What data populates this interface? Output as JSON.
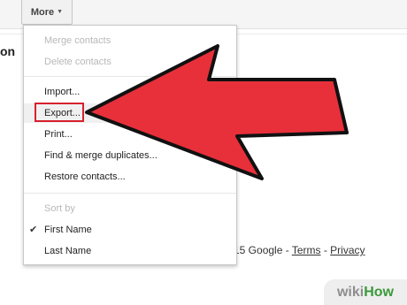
{
  "toolbar": {
    "more_label": "More",
    "more_caret": "▼"
  },
  "page": {
    "heading_fragment": "on"
  },
  "menu": {
    "merge": "Merge contacts",
    "delete": "Delete contacts",
    "import": "Import...",
    "export": "Export...",
    "print": "Print...",
    "find_merge": "Find & merge duplicates...",
    "restore": "Restore contacts...",
    "sort_by": "Sort by",
    "first_name": "First Name",
    "last_name": "Last Name",
    "check_glyph": "✔"
  },
  "footer": {
    "copyright": "15 Google - ",
    "sep": " - ",
    "terms": "Terms",
    "privacy": "Privacy"
  },
  "watermark": {
    "part1": "wiki",
    "part2": "How"
  },
  "colors": {
    "arrow_fill": "#e8303a",
    "highlight": "#d8202d"
  }
}
